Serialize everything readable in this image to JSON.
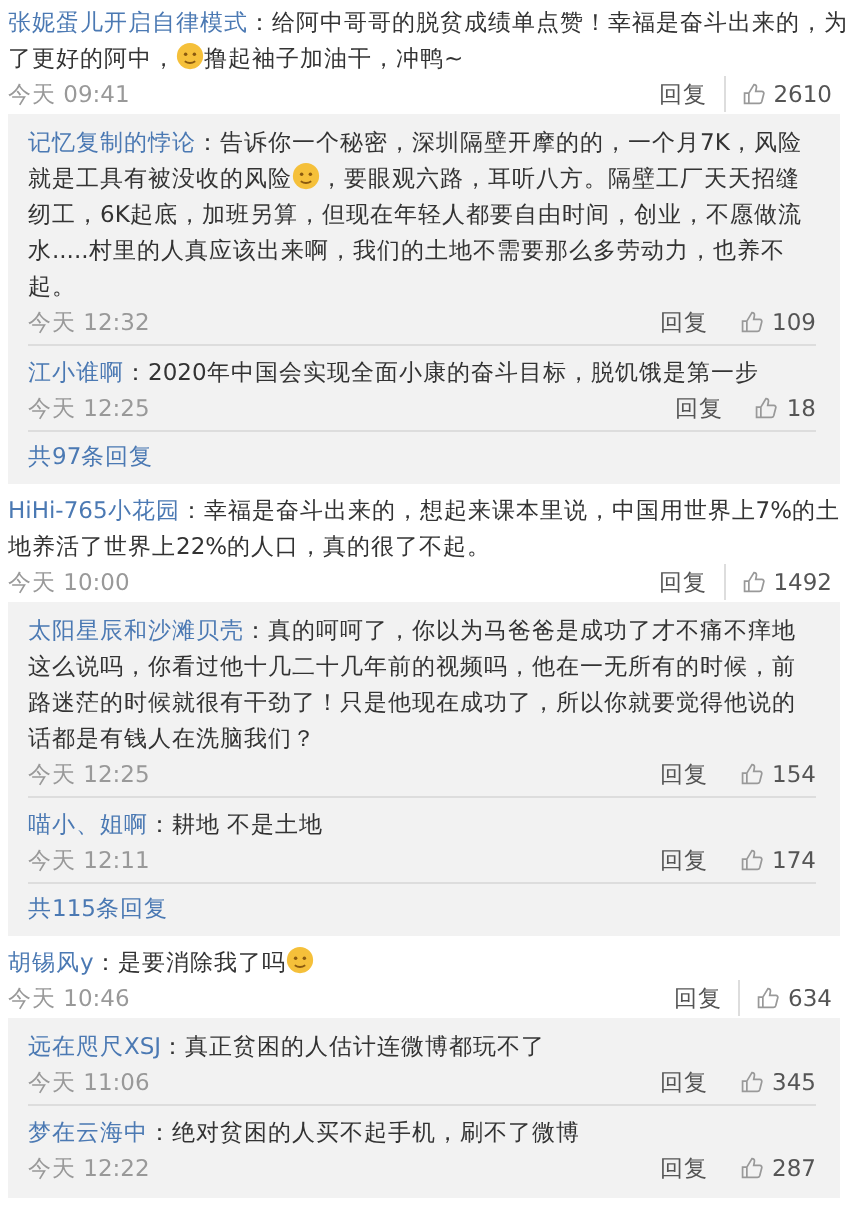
{
  "comments": [
    {
      "user": "张妮蛋儿开启自律模式",
      "segments": [
        {
          "kind": "text",
          "text": "：给阿中哥哥的脱贫成绩单点赞！幸福是奋斗出来的，为了更好的阿中，"
        },
        {
          "kind": "emoji"
        },
        {
          "kind": "text",
          "text": "撸起袖子加油干，冲鸭~"
        }
      ],
      "time": "今天 09:41",
      "reply": "回复",
      "likes": "2610",
      "replies": [
        {
          "user": "记忆复制的悖论",
          "segments": [
            {
              "kind": "text",
              "text": "：告诉你一个秘密，深圳隔壁开摩的的，一个月7K，风险就是工具有被没收的风险"
            },
            {
              "kind": "emoji"
            },
            {
              "kind": "text",
              "text": "，要眼观六路，耳听八方。隔壁工厂天天招缝纫工，6K起底，加班另算，但现在年轻人都要自由时间，创业，不愿做流水.....村里的人真应该出来啊，我们的土地不需要那么多劳动力，也养不起。"
            }
          ],
          "time": "今天 12:32",
          "reply": "回复",
          "likes": "109"
        },
        {
          "user": "江小谁啊",
          "segments": [
            {
              "kind": "text",
              "text": "：2020年中国会实现全面小康的奋斗目标，脱饥饿是第一步"
            }
          ],
          "time": "今天 12:25",
          "reply": "回复",
          "likes": "18"
        }
      ],
      "more": "共97条回复"
    },
    {
      "user": "HiHi-765小花园",
      "segments": [
        {
          "kind": "text",
          "text": "：幸福是奋斗出来的，想起来课本里说，中国用世界上7%的土地养活了世界上22%的人口，真的很了不起。"
        }
      ],
      "time": "今天 10:00",
      "reply": "回复",
      "likes": "1492",
      "replies": [
        {
          "user": "太阳星辰和沙滩贝壳",
          "segments": [
            {
              "kind": "text",
              "text": "：真的呵呵了，你以为马爸爸是成功了才不痛不痒地这么说吗，你看过他十几二十几年前的视频吗，他在一无所有的时候，前路迷茫的时候就很有干劲了！只是他现在成功了，所以你就要觉得他说的话都是有钱人在洗脑我们？"
            }
          ],
          "time": "今天 12:25",
          "reply": "回复",
          "likes": "154"
        },
        {
          "user": "喵小、姐啊",
          "segments": [
            {
              "kind": "text",
              "text": "：耕地  不是土地"
            }
          ],
          "time": "今天 12:11",
          "reply": "回复",
          "likes": "174"
        }
      ],
      "more": "共115条回复"
    },
    {
      "user": "胡锡风y",
      "segments": [
        {
          "kind": "text",
          "text": "：是要消除我了吗"
        },
        {
          "kind": "emoji"
        }
      ],
      "time": "今天 10:46",
      "reply": "回复",
      "likes": "634",
      "replies": [
        {
          "user": "远在咫尺XSJ",
          "segments": [
            {
              "kind": "text",
              "text": "：真正贫困的人估计连微博都玩不了"
            }
          ],
          "time": "今天 11:06",
          "reply": "回复",
          "likes": "345"
        },
        {
          "user": "梦在云海中",
          "segments": [
            {
              "kind": "text",
              "text": "：绝对贫困的人买不起手机，刷不了微博"
            }
          ],
          "time": "今天 12:22",
          "reply": "回复",
          "likes": "287"
        }
      ]
    }
  ]
}
